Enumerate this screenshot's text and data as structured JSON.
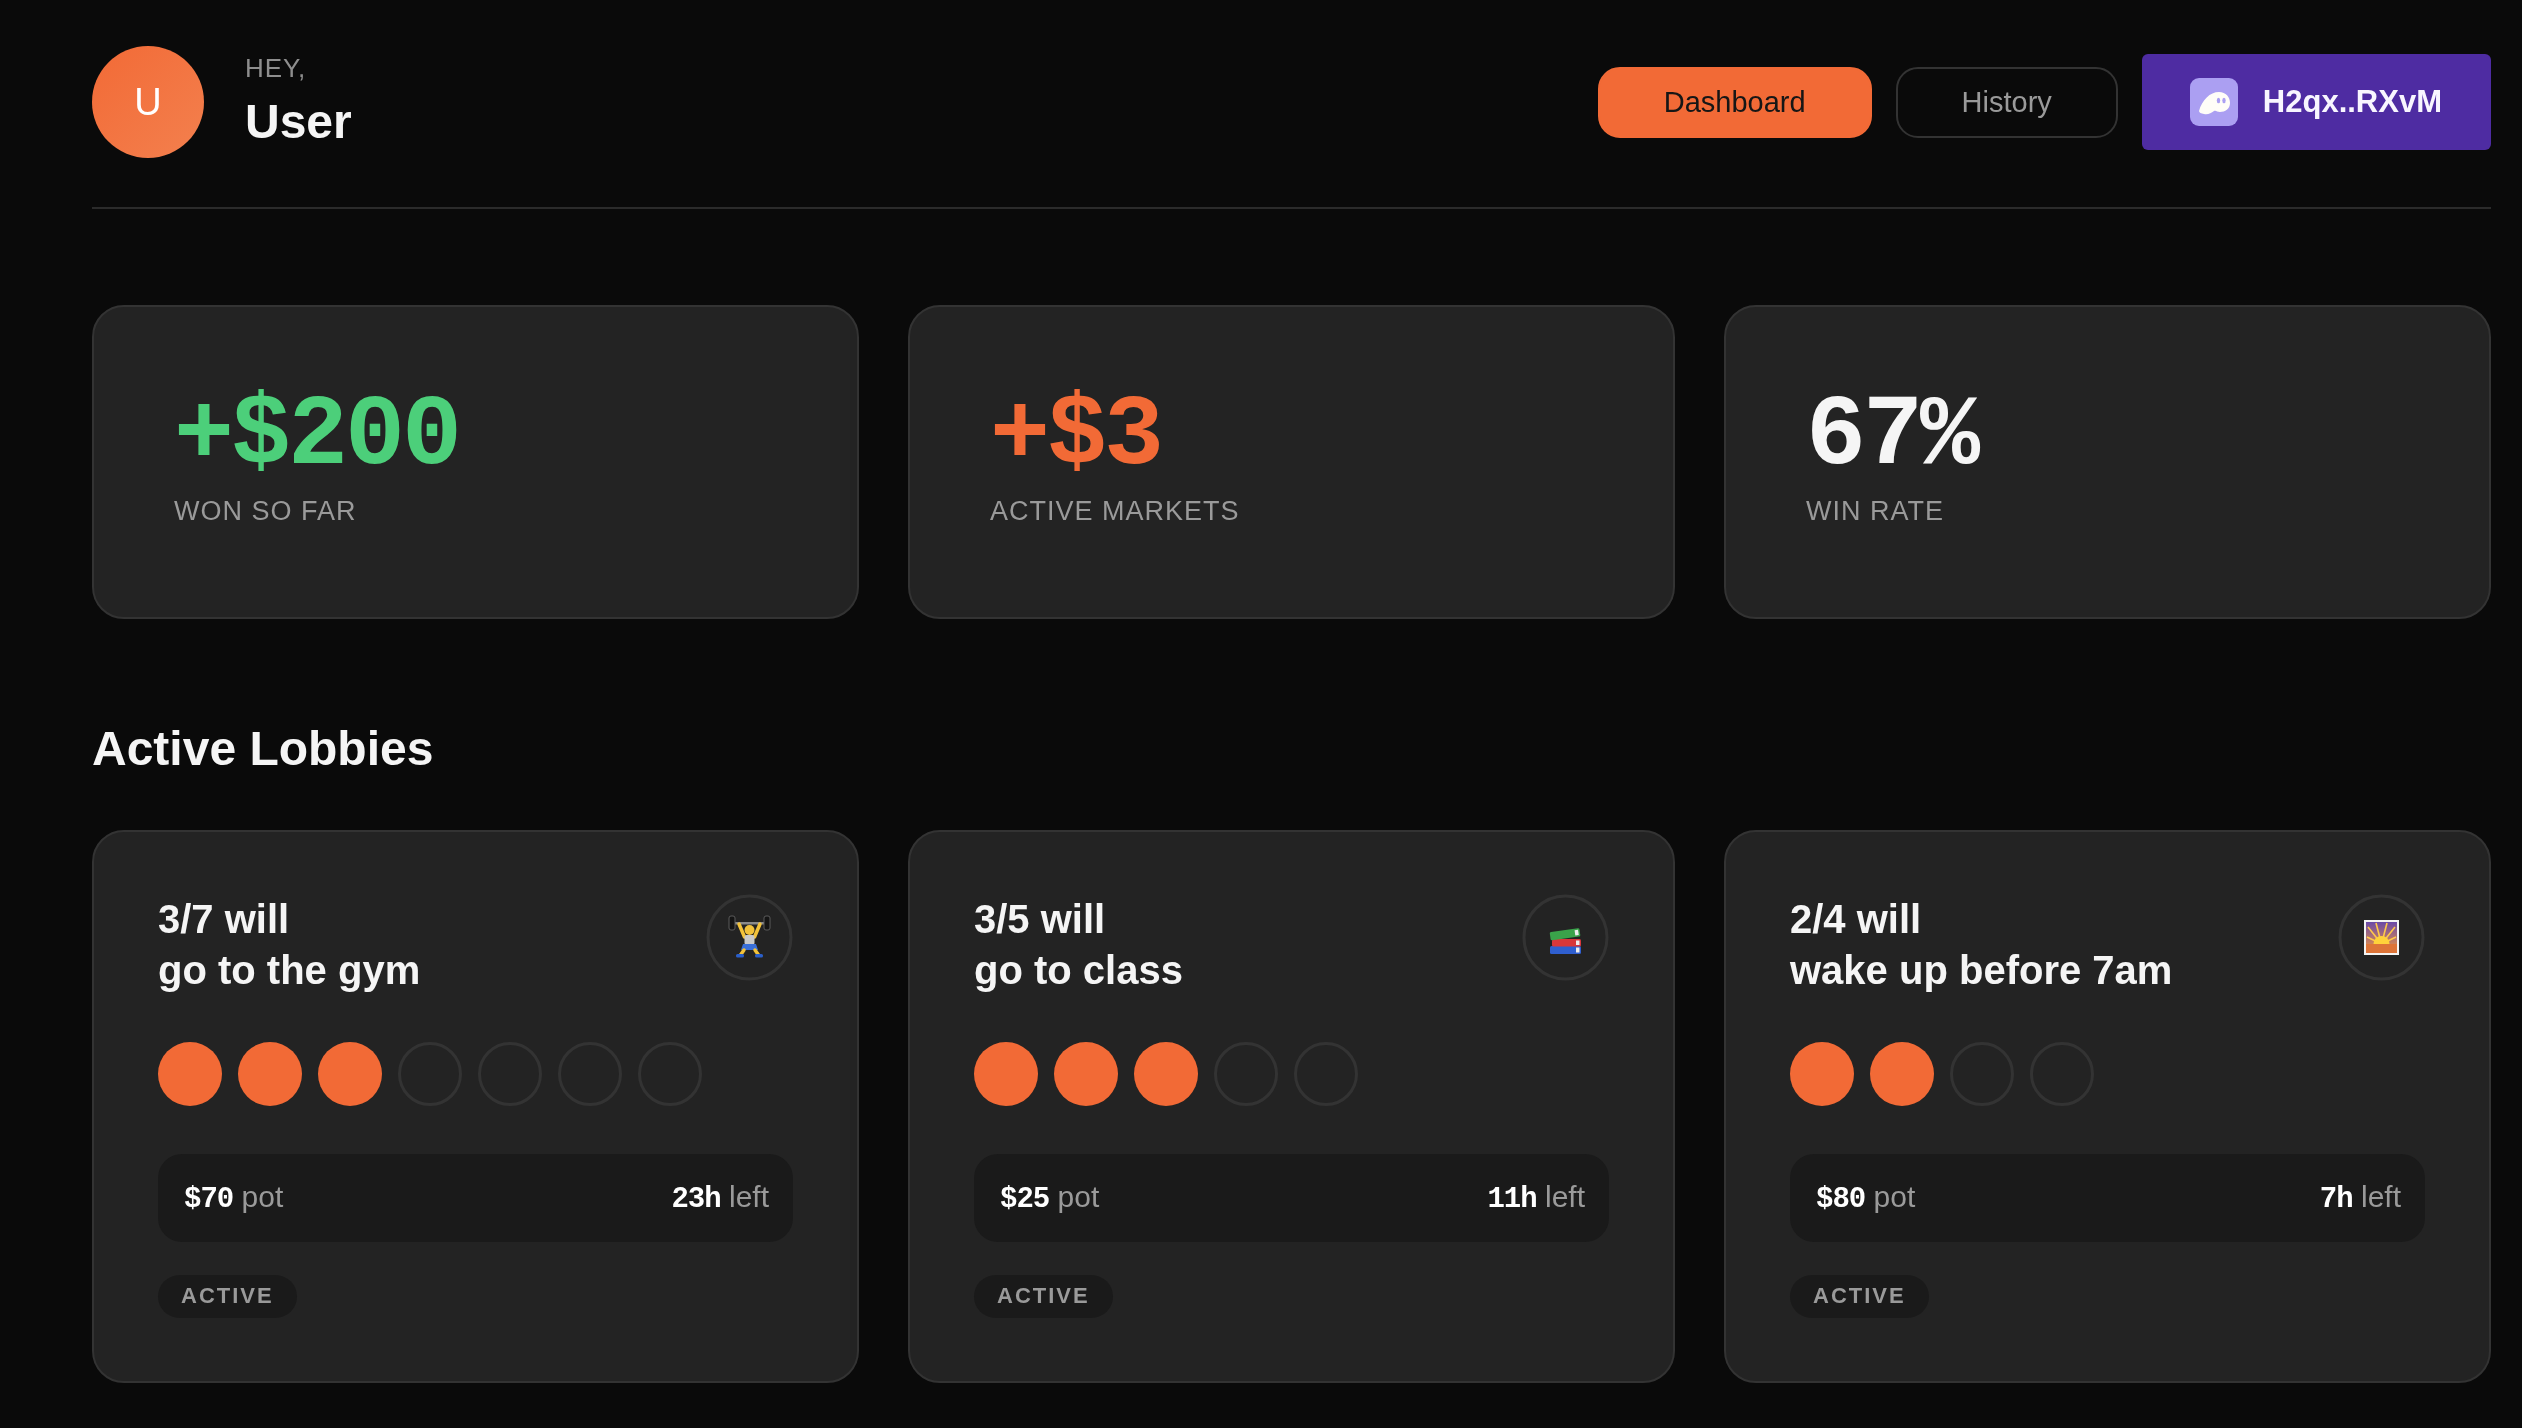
{
  "header": {
    "avatar_initial": "U",
    "greeting": "HEY,",
    "name": "User"
  },
  "nav": [
    {
      "label": "Dashboard",
      "selected": true
    },
    {
      "label": "History",
      "selected": false
    }
  ],
  "wallet": {
    "address": "H2qx..RXvM"
  },
  "stats": [
    {
      "value": "+$200",
      "label": "WON SO FAR",
      "color": "#4ccf7a"
    },
    {
      "value": "+$3",
      "label": "ACTIVE MARKETS",
      "color": "#f26a36"
    },
    {
      "value": "67%",
      "label": "WIN RATE",
      "color": "#f5f5f5"
    }
  ],
  "section_title": "Active Lobbies",
  "lobbies": [
    {
      "title": "3/7 will",
      "goal": "go to the gym",
      "slots": [
        {
          "filled": true
        },
        {
          "filled": true
        },
        {
          "filled": true
        },
        {
          "filled": false
        },
        {
          "filled": false
        },
        {
          "filled": false
        },
        {
          "filled": false
        }
      ],
      "pot": "**$70** pot",
      "time_left": "**23h** left",
      "status": "ACTIVE"
    },
    {
      "title": "3/5 will",
      "goal": "go to class",
      "slots": [
        {
          "filled": true
        },
        {
          "filled": true
        },
        {
          "filled": true
        },
        {
          "filled": false
        },
        {
          "filled": false
        }
      ],
      "pot": "**$25** pot",
      "time_left": "**11h** left",
      "status": "ACTIVE"
    },
    {
      "title": "2/4 will",
      "goal": "wake up before 7am",
      "slots": [
        {
          "filled": true
        },
        {
          "filled": true
        },
        {
          "filled": false
        },
        {
          "filled": false
        }
      ],
      "pot": "**$80** pot",
      "time_left": "**7h** left",
      "status": "ACTIVE"
    }
  ]
}
